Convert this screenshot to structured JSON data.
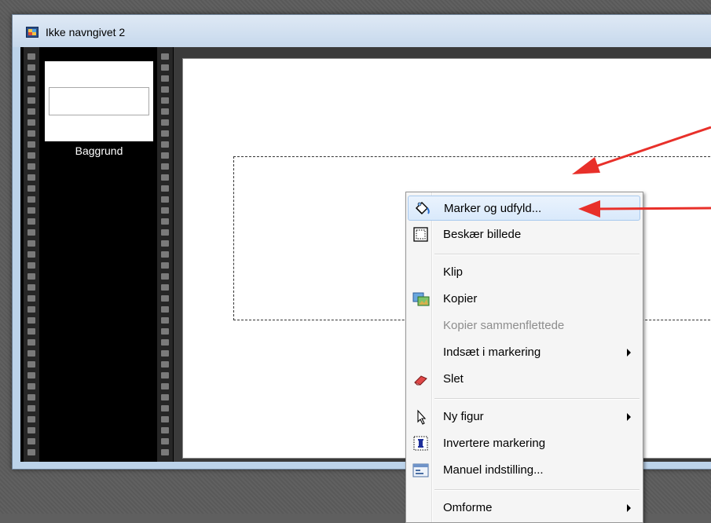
{
  "window": {
    "title": "Ikke navngivet 2"
  },
  "filmstrip": {
    "thumbnail_label": "Baggrund"
  },
  "context_menu": {
    "items": [
      {
        "label": "Marker og udfyld...",
        "icon": "fill-bucket-icon",
        "highlighted": true
      },
      {
        "label": "Beskær billede",
        "icon": "crop-icon"
      },
      {
        "label": "Klip"
      },
      {
        "label": "Kopier",
        "icon": "copy-image-icon"
      },
      {
        "label": "Kopier sammenflettede",
        "disabled": true
      },
      {
        "label": "Indsæt i markering",
        "submenu": true
      },
      {
        "label": "Slet",
        "icon": "eraser-icon"
      },
      {
        "label": "Ny figur",
        "icon": "cursor-icon",
        "submenu": true
      },
      {
        "label": "Invertere markering",
        "icon": "invert-selection-icon"
      },
      {
        "label": "Manuel indstilling...",
        "icon": "manual-settings-icon"
      },
      {
        "label": "Omforme",
        "submenu": true
      }
    ]
  },
  "annotation_color": "#e8302a",
  "accent_color": "#bcd3ea"
}
